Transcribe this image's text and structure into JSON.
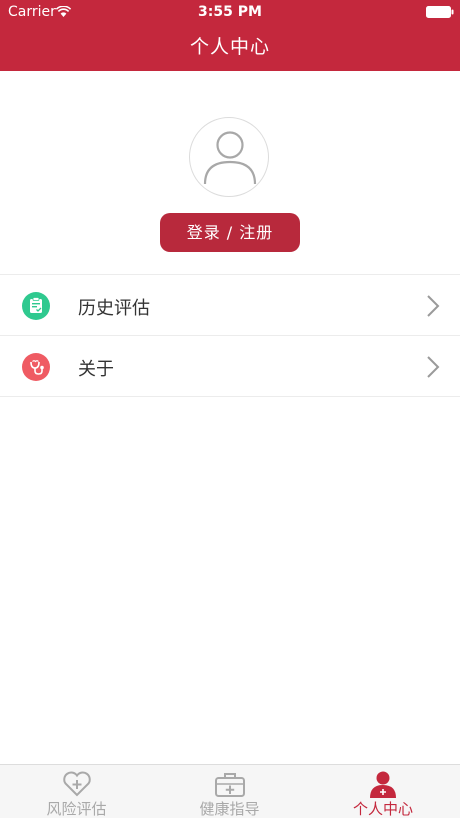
{
  "status_bar": {
    "carrier": "Carrier",
    "time": "3:55 PM"
  },
  "nav": {
    "title": "个人中心"
  },
  "profile": {
    "login_label": "登录 / 注册"
  },
  "menu": {
    "items": [
      {
        "label": "历史评估",
        "icon": "clipboard-icon",
        "icon_color": "#2fc98f"
      },
      {
        "label": "关于",
        "icon": "stethoscope-icon",
        "icon_color": "#ef5b63"
      }
    ]
  },
  "tab_bar": {
    "tabs": [
      {
        "label": "风险评估",
        "icon": "heart-plus-icon",
        "active": false
      },
      {
        "label": "健康指导",
        "icon": "medical-kit-icon",
        "active": false
      },
      {
        "label": "个人中心",
        "icon": "profile-plus-icon",
        "active": true
      }
    ]
  },
  "colors": {
    "brand": "#c4283d",
    "inactive": "#a9a9a9"
  }
}
